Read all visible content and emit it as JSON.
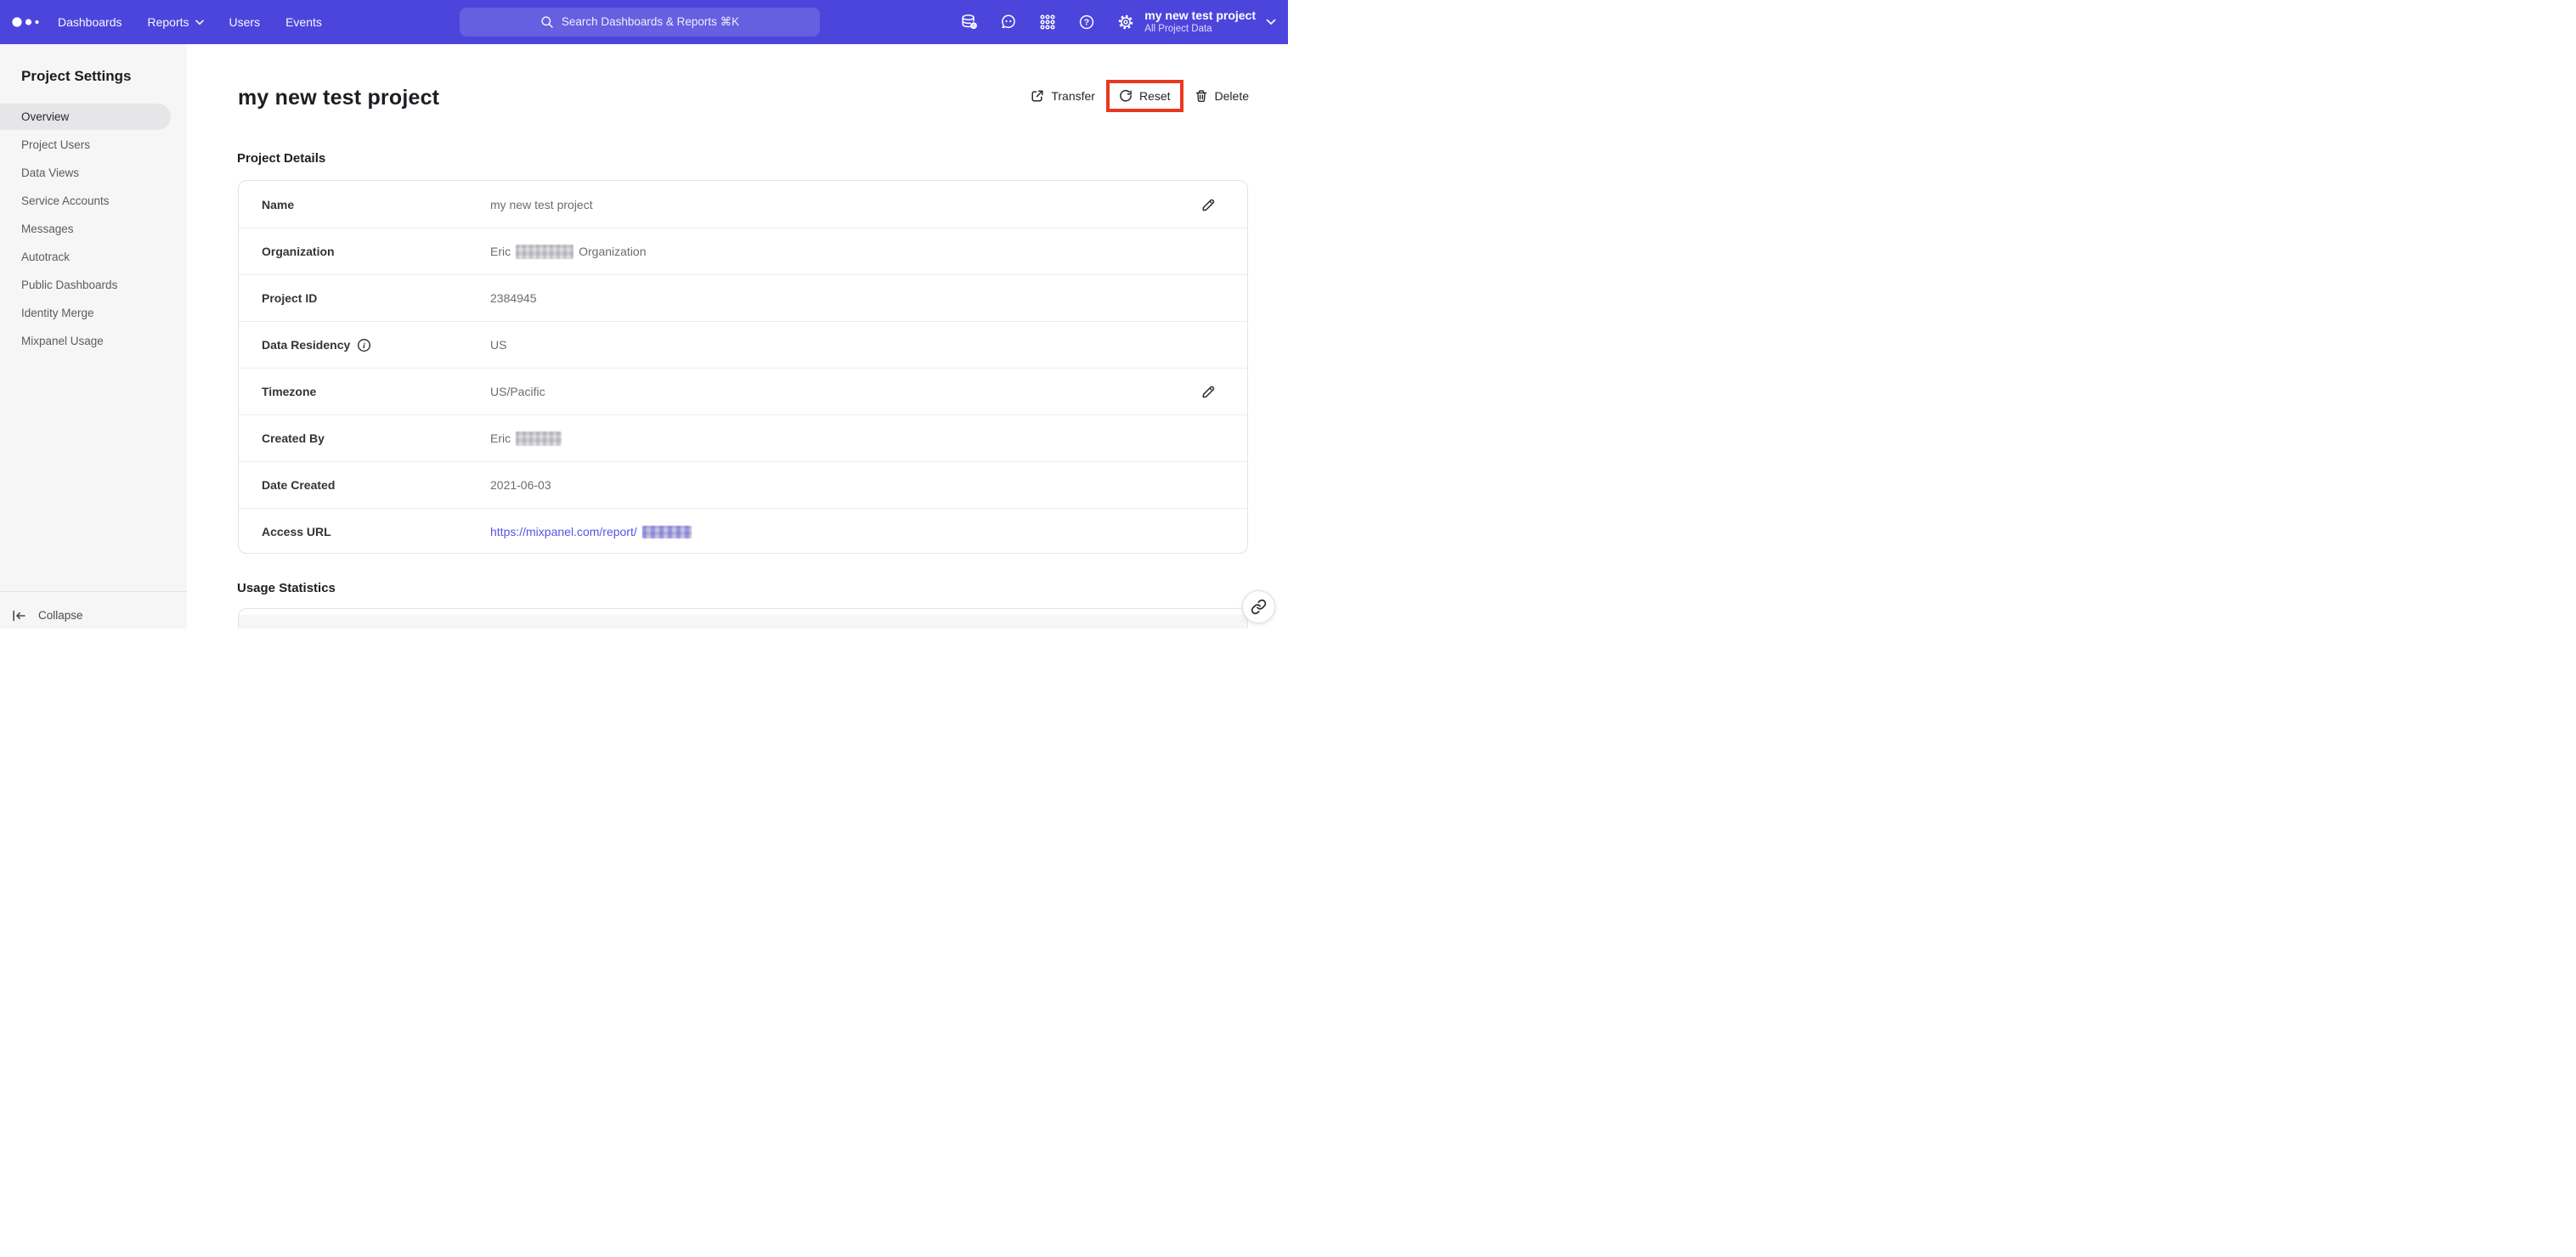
{
  "colors": {
    "navbar": "#4c45dc",
    "highlight_box": "#e8391f",
    "link": "#5853e6",
    "sidebar_bg": "#f6f6f7",
    "active_pill": "#e6e6e9"
  },
  "navbar": {
    "logo": "mixpanel-dots-logo",
    "links": [
      {
        "label": "Dashboards"
      },
      {
        "label": "Reports",
        "has_chevron": true
      },
      {
        "label": "Users"
      },
      {
        "label": "Events"
      }
    ],
    "search": {
      "placeholder": "Search Dashboards & Reports ⌘K",
      "icon": "search-icon"
    },
    "icons": [
      "data-management-icon",
      "feedback-bubble-icon",
      "apps-grid-icon",
      "help-icon",
      "settings-gear-icon"
    ],
    "project_switcher": {
      "name": "my new test project",
      "scope": "All Project Data",
      "icon": "chevron-down-icon"
    }
  },
  "sidebar": {
    "title": "Project Settings",
    "items": [
      {
        "label": "Overview",
        "active": true
      },
      {
        "label": "Project Users"
      },
      {
        "label": "Data Views"
      },
      {
        "label": "Service Accounts"
      },
      {
        "label": "Messages"
      },
      {
        "label": "Autotrack"
      },
      {
        "label": "Public Dashboards"
      },
      {
        "label": "Identity Merge"
      },
      {
        "label": "Mixpanel Usage"
      }
    ],
    "collapse_label": "Collapse"
  },
  "main": {
    "title": "my new test project",
    "actions": {
      "transfer": "Transfer",
      "reset": "Reset",
      "delete": "Delete"
    },
    "annotation": {
      "type": "highlight-box",
      "target": "reset-button",
      "color": "#e8391f"
    },
    "details": {
      "heading": "Project Details",
      "rows": [
        {
          "label": "Name",
          "value": "my new test project",
          "editable": true
        },
        {
          "label": "Organization",
          "value_prefix": "Eric",
          "value_suffix": "Organization",
          "redacted": true
        },
        {
          "label": "Project ID",
          "value": "2384945"
        },
        {
          "label": "Data Residency",
          "value": "US",
          "has_info_icon": true
        },
        {
          "label": "Timezone",
          "value": "US/Pacific",
          "editable": true
        },
        {
          "label": "Created By",
          "value_prefix": "Eric",
          "redacted": true
        },
        {
          "label": "Date Created",
          "value": "2021-06-03"
        },
        {
          "label": "Access URL",
          "link_text": "https://mixpanel.com/report/",
          "redacted": true
        }
      ]
    },
    "usage": {
      "heading": "Usage Statistics"
    }
  }
}
